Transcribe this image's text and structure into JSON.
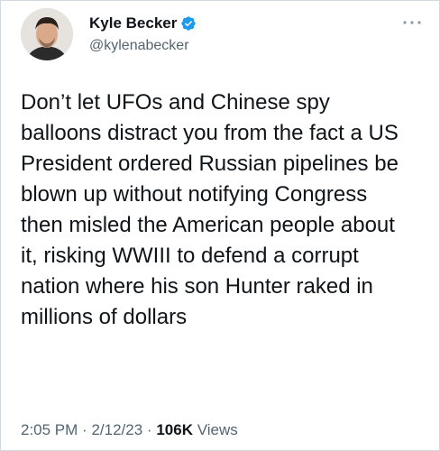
{
  "author": {
    "name": "Kyle Becker",
    "handle": "@kylenabecker",
    "verified_color": "#1d9bf0"
  },
  "tweet": {
    "text": "Don’t let UFOs and Chinese spy balloons distract you from the fact a US President ordered Russian pipelines be blown up without notifying Congress then misled the American people about it, risking WWIII to defend a corrupt nation where his son Hunter raked in millions of dollars"
  },
  "meta": {
    "time": "2:05 PM",
    "date": "2/12/23",
    "views_count": "106K",
    "views_label": "Views",
    "separator": "·"
  },
  "icons": {
    "more": "more-options-icon",
    "verified": "verified-badge-icon"
  }
}
